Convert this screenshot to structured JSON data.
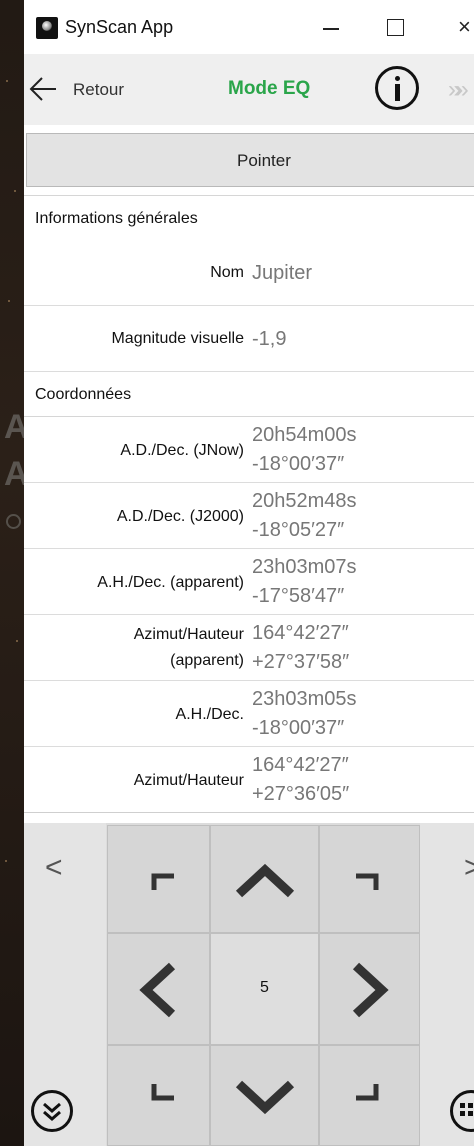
{
  "window": {
    "title": "SynScan App",
    "close_glyph": "×"
  },
  "navbar": {
    "back_label": "Retour",
    "mode_label": "Mode EQ",
    "forward_glyph": "»»"
  },
  "point_button": {
    "label": "Pointer"
  },
  "sections": {
    "general": "Informations générales",
    "coordinates": "Coordonnées"
  },
  "general_rows": [
    {
      "label": "Nom",
      "value": "Jupiter"
    },
    {
      "label": "Magnitude visuelle",
      "value": "-1,9"
    }
  ],
  "coord_rows": [
    {
      "label": "A.D./Dec. (JNow)",
      "value1": "20h54m00s",
      "value2": "-18°00′37″"
    },
    {
      "label": "A.D./Dec. (J2000)",
      "value1": "20h52m48s",
      "value2": "-18°05′27″"
    },
    {
      "label": "A.H./Dec. (apparent)",
      "value1": "23h03m07s",
      "value2": "-17°58′47″"
    },
    {
      "label_line1": "Azimut/Hauteur",
      "label_line2": "(apparent)",
      "value1": "164°42′27″",
      "value2": "+27°37′58″"
    },
    {
      "label": "A.H./Dec.",
      "value1": "23h03m05s",
      "value2": "-18°00′37″"
    },
    {
      "label": "Azimut/Hauteur",
      "value1": "164°42′27″",
      "value2": "+27°36′05″"
    }
  ],
  "pad": {
    "speed": "5",
    "left_chevron": "<",
    "right_chevron": ">"
  },
  "background": {
    "ghost_letters": [
      "A",
      "A"
    ]
  },
  "colors": {
    "mode_green": "#2aa54a",
    "value_gray": "#777777",
    "pad_gray": "#d6d6d6"
  }
}
